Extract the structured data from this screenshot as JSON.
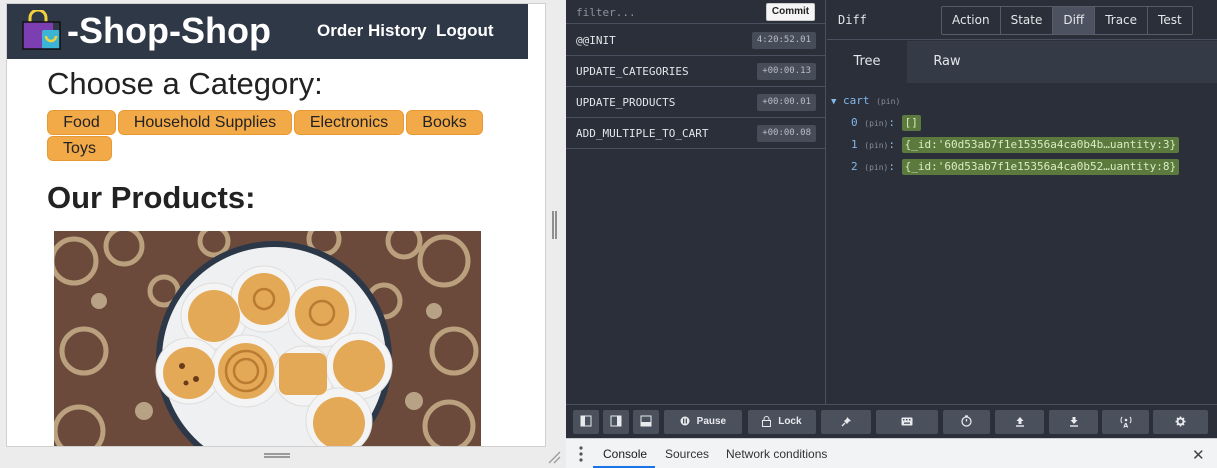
{
  "shop": {
    "brand": "-Shop-Shop",
    "nav": {
      "order_history": "Order History",
      "logout": "Logout"
    },
    "category_heading": "Choose a Category:",
    "categories": [
      "Food",
      "Household Supplies",
      "Electronics",
      "Books",
      "Toys"
    ],
    "products_heading": "Our Products:"
  },
  "devtools": {
    "filter_placeholder": "filter...",
    "commit_label": "Commit",
    "actions": [
      {
        "name": "@@INIT",
        "time": "4:20:52.01"
      },
      {
        "name": "UPDATE_CATEGORIES",
        "time": "+00:00.13"
      },
      {
        "name": "UPDATE_PRODUCTS",
        "time": "+00:00.01"
      },
      {
        "name": "ADD_MULTIPLE_TO_CART",
        "time": "+00:00.08"
      }
    ],
    "state_title": "Diff",
    "mode_tabs": [
      "Action",
      "State",
      "Diff",
      "Trace",
      "Test"
    ],
    "active_mode": "Diff",
    "view_tabs": [
      "Tree",
      "Raw"
    ],
    "tree": {
      "root_key": "cart",
      "pin": "(pin)",
      "items": [
        {
          "key": "0",
          "value": "[]"
        },
        {
          "key": "1",
          "value": "{_id:'60d53ab7f1e15356a4ca0b4b…uantity:3}"
        },
        {
          "key": "2",
          "value": "{_id:'60d53ab7f1e15356a4ca0b52…uantity:8}"
        }
      ]
    },
    "toolbar": {
      "pause": "Pause",
      "lock": "Lock"
    }
  },
  "drawer": {
    "tabs": [
      "Console",
      "Sources",
      "Network conditions"
    ]
  },
  "colors": {
    "header_bg": "#2f3847",
    "category_btn": "#f2a948",
    "devtools_bg": "#2a2f3a",
    "diff_value_bg": "#5c7a3e",
    "drawer_active": "#1a73e8"
  }
}
